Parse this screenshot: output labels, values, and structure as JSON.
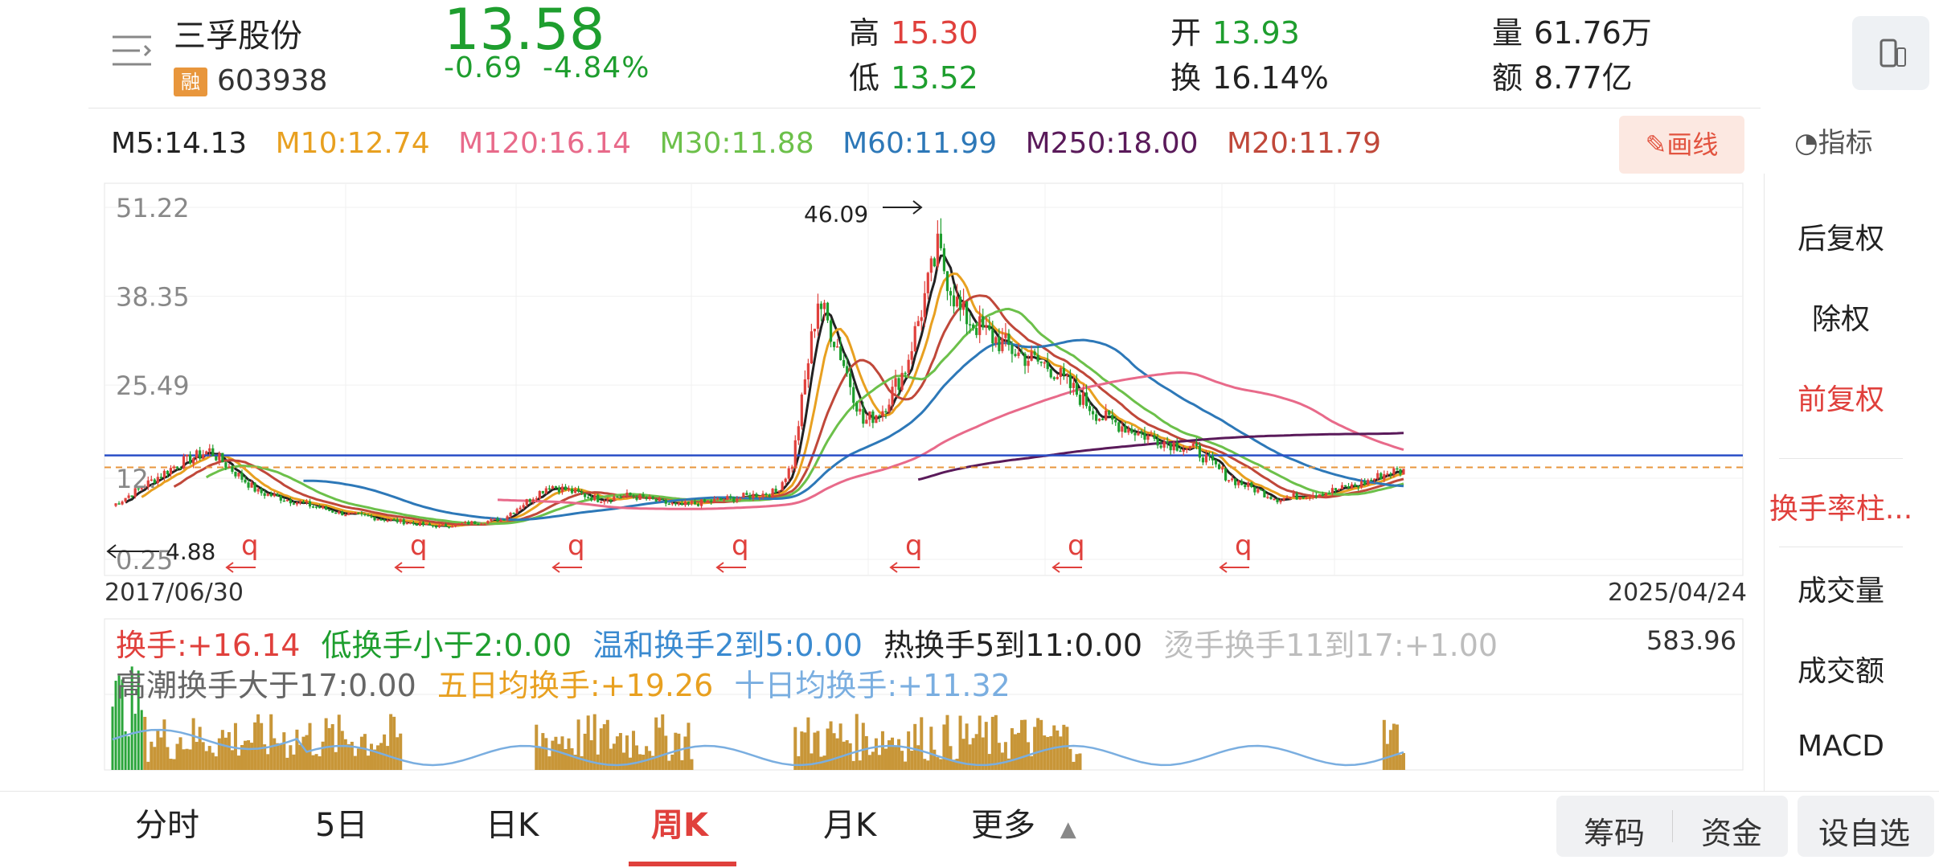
{
  "header": {
    "name": "三孚股份",
    "badge": "融",
    "code": "603938",
    "price": "13.58",
    "change": "-0.69",
    "change_pct": "-4.84%",
    "high_label": "高",
    "high": "15.30",
    "low_label": "低",
    "low": "13.52",
    "open_label": "开",
    "open": "13.93",
    "turnover_label": "换",
    "turnover": "16.14%",
    "volume_label": "量",
    "volume": "61.76万",
    "amount_label": "额",
    "amount": "8.77亿"
  },
  "ma": [
    {
      "label": "M5:14.13",
      "color": "#222222"
    },
    {
      "label": "M10:12.74",
      "color": "#e8a020"
    },
    {
      "label": "M120:16.14",
      "color": "#e86a8a"
    },
    {
      "label": "M30:11.88",
      "color": "#6cc04a"
    },
    {
      "label": "M60:11.99",
      "color": "#2d78b8"
    },
    {
      "label": "M250:18.00",
      "color": "#5a1a5a"
    },
    {
      "label": "M20:11.79",
      "color": "#c0483a"
    }
  ],
  "toolbar": {
    "draw_label": "画线",
    "indicator_label": "指标"
  },
  "side_menu": [
    "后复权",
    "除权",
    "前复权",
    "换手率柱...",
    "成交量",
    "成交额",
    "MACD"
  ],
  "side_active": "前复权",
  "chart_data": [
    {
      "type": "candlestick",
      "period": "weekly",
      "x_start": "2017/06/30",
      "x_end": "2025/04/24",
      "y_ticks": [
        "51.22",
        "38.35",
        "25.49",
        "12.",
        "0.25"
      ],
      "max_annotation": "46.09",
      "min_annotation": "4.88",
      "event_marker": "q",
      "reference_line_color": "#2a4fc7",
      "current_price_line_color": "#e8963c"
    },
    {
      "type": "bar",
      "title": "换手",
      "max_label": "583.96",
      "legend": [
        {
          "label": "换手:+16.14",
          "color": "#e0403c"
        },
        {
          "label": "低换手小于2:0.00",
          "color": "#1e9e2e"
        },
        {
          "label": "温和换手2到5:0.00",
          "color": "#3a8ad0"
        },
        {
          "label": "热换手5到11:0.00",
          "color": "#222222"
        },
        {
          "label": "烫手换手11到17:+1.00",
          "color": "#bdbdbd"
        },
        {
          "label": "高潮换手大于17:0.00",
          "color": "#666666"
        },
        {
          "label": "五日均换手:+19.26",
          "color": "#e8a020"
        },
        {
          "label": "十日均换手:+11.32",
          "color": "#7aaee0"
        }
      ]
    }
  ],
  "tabs": [
    "分时",
    "5日",
    "日K",
    "周K",
    "月K",
    "更多"
  ],
  "tab_active": "周K",
  "bottom_buttons": {
    "chips": "筹码",
    "funds": "资金",
    "watch": "设自选"
  }
}
